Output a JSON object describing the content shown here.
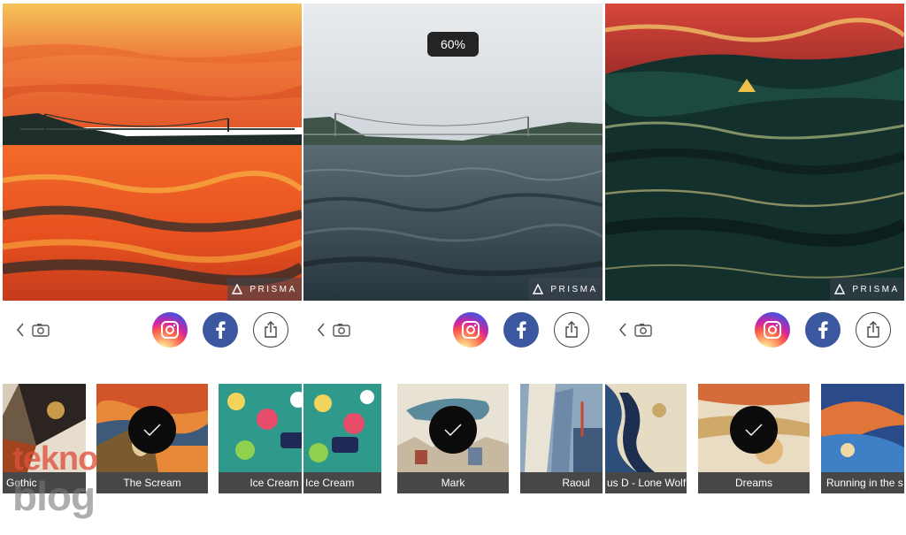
{
  "panels": [
    {
      "style": "orange-wave",
      "watermark": "PRISMA",
      "filters": [
        {
          "label": "Gothic",
          "selected": false,
          "style": "gothic"
        },
        {
          "label": "The Scream",
          "selected": true,
          "style": "scream"
        },
        {
          "label": "Ice Cream",
          "selected": false,
          "style": "icecream"
        }
      ]
    },
    {
      "style": "original",
      "watermark": "PRISMA",
      "intensity": "60%",
      "filters": [
        {
          "label": "Ice Cream",
          "selected": false,
          "style": "icecream"
        },
        {
          "label": "Mark",
          "selected": true,
          "style": "mark"
        },
        {
          "label": "Raoul",
          "selected": false,
          "style": "raoul"
        }
      ]
    },
    {
      "style": "dark-sea",
      "watermark": "PRISMA",
      "filters": [
        {
          "label": "us D - Lone Wolf",
          "selected": false,
          "style": "lonewolf"
        },
        {
          "label": "Dreams",
          "selected": true,
          "style": "dreams"
        },
        {
          "label": "Running in the s",
          "selected": false,
          "style": "running"
        }
      ]
    }
  ],
  "toolbar": {
    "icons": [
      "back-chevron-icon",
      "camera-icon",
      "instagram-icon",
      "facebook-icon",
      "share-icon"
    ]
  },
  "site_logo": {
    "line1": "tekno",
    "line2": "blog"
  },
  "colors": {
    "instagram": "#d6249f",
    "facebook": "#3a57a0",
    "label_bg": "#1e1e1e"
  }
}
